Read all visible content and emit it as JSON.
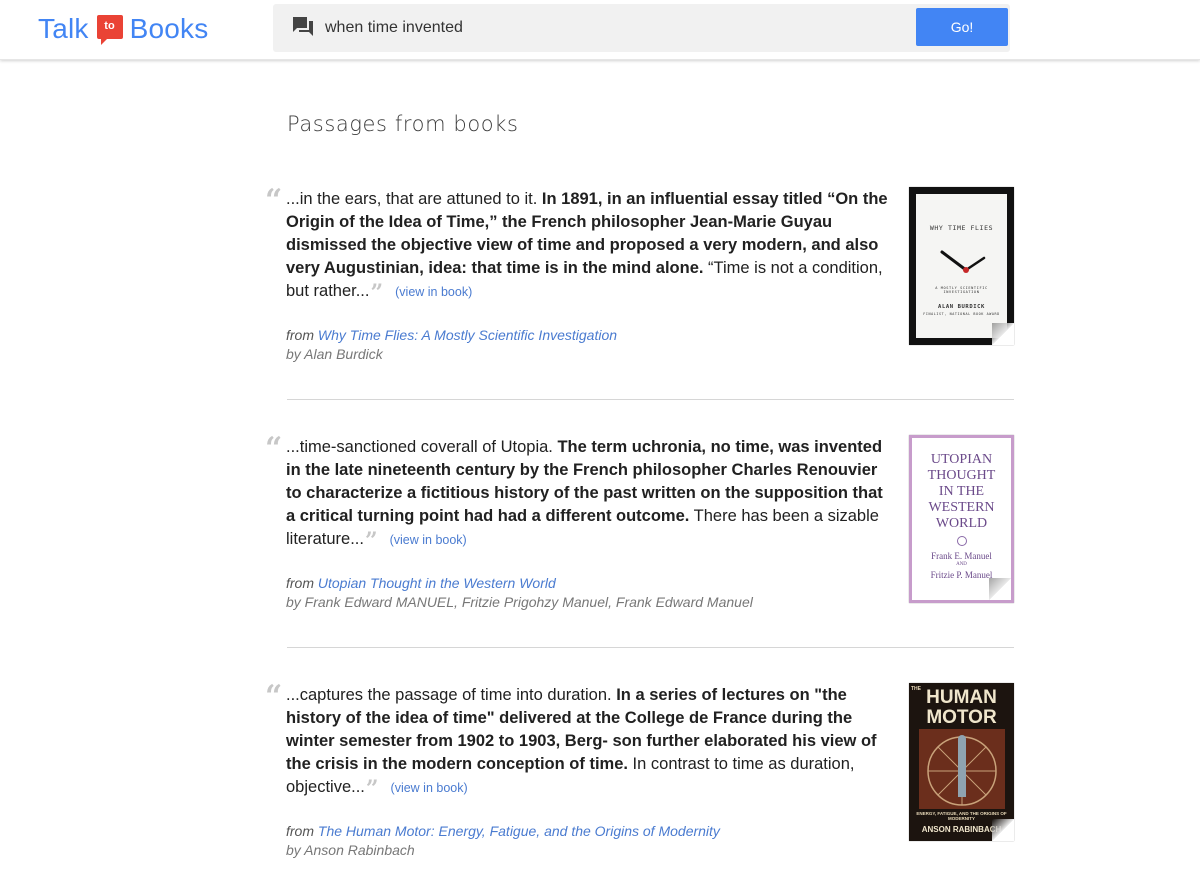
{
  "header": {
    "logo": {
      "left": "Talk",
      "badge": "to",
      "right": "Books",
      "brand_color": "#4285f4",
      "badge_color": "#ea4335"
    },
    "search": {
      "query": "when time invented",
      "icon": "chat-bubble-icon"
    },
    "go_label": "Go!",
    "go_color": "#4285f4"
  },
  "main": {
    "section_title": "Passages from books",
    "results": [
      {
        "lead": "...in the ears, that are attuned to it. ",
        "bold": "In 1891, in an influential essay titled “On the Origin of the Idea of Time,” the French philosopher Jean-Marie Guyau dismissed the objective view of time and proposed a very modern, and also very Augustinian, idea: that time is in the mind alone.",
        "tail": " “Time is not a condition, but rather...",
        "view_label": "(view in book)",
        "from_label": "from",
        "book_title": "Why Time Flies: A Mostly Scientific Investigation",
        "author_line": "by Alan Burdick",
        "cover": {
          "title": "WHY TIME FLIES",
          "subtitle": "A MOSTLY SCIENTIFIC INVESTIGATION",
          "author": "ALAN BURDICK",
          "tagline": "FINALIST, NATIONAL BOOK AWARD"
        }
      },
      {
        "lead": "...time-sanctioned coverall of Utopia. ",
        "bold": "The term uchronia, no time, was invented in the late nineteenth century by the French philosopher Charles Renouvier to characterize a fictitious history of the past written on the supposition that a critical turning point had had a different outcome.",
        "tail": " There has been a sizable literature...",
        "view_label": "(view in book)",
        "from_label": "from",
        "book_title": "Utopian Thought in the Western World",
        "author_line": "by Frank Edward MANUEL, Fritzie Prigohzy Manuel, Frank Edward Manuel",
        "cover": {
          "line1": "UTOPIAN",
          "line2": "THOUGHT",
          "line3": "IN THE",
          "line4": "WESTERN",
          "line5": "WORLD",
          "author1": "Frank E. Manuel",
          "and": "AND",
          "author2": "Fritzie P. Manuel"
        }
      },
      {
        "lead": "...captures the passage of time into duration. ",
        "bold": "In a series of lectures on \"the history of the idea of time\" delivered at the College de France during the winter semester from 1902 to 1903, Berg- son further elaborated his view of the crisis in the modern conception of time.",
        "tail": " In contrast to time as duration, objective...",
        "view_label": "(view in book)",
        "from_label": "from",
        "book_title": "The Human Motor: Energy, Fatigue, and the Origins of Modernity",
        "author_line": "by Anson Rabinbach",
        "cover": {
          "the": "THE",
          "title1": "HUMAN",
          "title2": "MOTOR",
          "subtitle": "ENERGY, FATIGUE, AND THE ORIGINS OF MODERNITY",
          "author": "ANSON RABINBACH"
        }
      }
    ]
  }
}
